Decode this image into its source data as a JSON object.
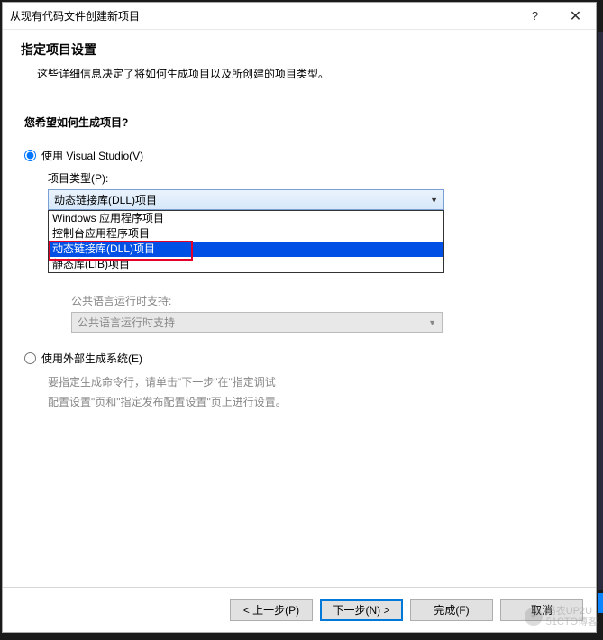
{
  "title": "从现有代码文件创建新项目",
  "header": {
    "title": "指定项目设置",
    "desc": "这些详细信息决定了将如何生成项目以及所创建的项目类型。"
  },
  "question": "您希望如何生成项目?",
  "radio1": {
    "label": "使用 Visual Studio(V)",
    "projectTypeLabel": "项目类型(P):",
    "selected": "动态链接库(DLL)项目"
  },
  "dropdown": {
    "items": [
      "Windows 应用程序项目",
      "控制台应用程序项目",
      "动态链接库(DLL)项目",
      "静态库(LIB)项目"
    ]
  },
  "clr": {
    "label": "公共语言运行时支持:",
    "value": "公共语言运行时支持"
  },
  "radio2": {
    "label": "使用外部生成系统(E)",
    "hint1": "要指定生成命令行，请单击\"下一步\"在\"指定调试",
    "hint2": "配置设置\"页和\"指定发布配置设置\"页上进行设置。"
  },
  "buttons": {
    "prev": "< 上一步(P)",
    "next": "下一步(N) >",
    "finish": "完成(F)",
    "cancel": "取消"
  },
  "watermark": "码农UP2U\n51CTO博客"
}
